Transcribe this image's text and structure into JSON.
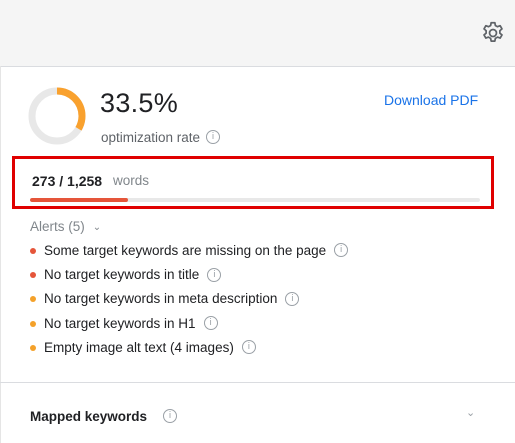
{
  "header": {
    "settings_icon": "gear-icon"
  },
  "optimization": {
    "rate_value": "33.5%",
    "rate_fraction": 0.335,
    "rate_label": "optimization rate",
    "download_label": "Download PDF"
  },
  "words": {
    "count_text": "273 / 1,258",
    "label": "words",
    "progress_fraction": 0.217
  },
  "alerts": {
    "header": "Alerts (5)",
    "items": [
      {
        "text": "Some target keywords are missing on the page",
        "severity": "error"
      },
      {
        "text": "No target keywords in title",
        "severity": "error"
      },
      {
        "text": "No target keywords in meta description",
        "severity": "warning"
      },
      {
        "text": "No target keywords in H1",
        "severity": "warning"
      },
      {
        "text": "Empty image alt text (4 images)",
        "severity": "warning"
      }
    ]
  },
  "mapped_keywords": {
    "label": "Mapped keywords"
  },
  "colors": {
    "donut_progress": "#f9a12e",
    "donut_track": "#e8e8e8",
    "link": "#1a73e8",
    "error": "#e5553a",
    "warning": "#f4a12a",
    "highlight_border": "#e00000"
  },
  "info_glyph": "i"
}
